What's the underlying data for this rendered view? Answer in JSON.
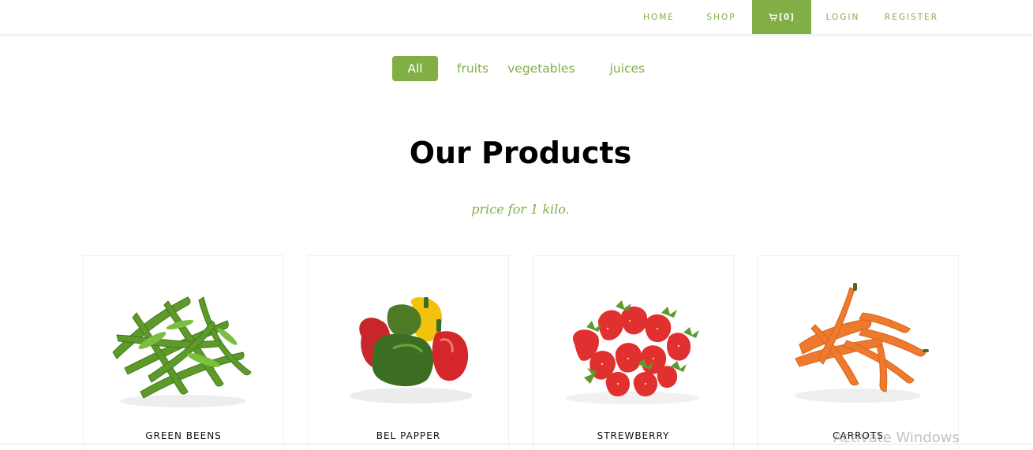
{
  "nav": {
    "home": "HOME",
    "shop": "SHOP",
    "cart": "[0]",
    "login": "LOGIN",
    "register": "REGISTER",
    "cart_icon": "cart-icon"
  },
  "filters": [
    {
      "label": "All",
      "active": true
    },
    {
      "label": "fruits",
      "active": false
    },
    {
      "label": "vegetables",
      "active": false
    },
    {
      "label": "juices",
      "active": false
    }
  ],
  "section": {
    "title": "Our Products",
    "subtitle": "price for 1 kilo."
  },
  "products": [
    {
      "name": "GREEN BEENS",
      "image": "green-beans-image"
    },
    {
      "name": "BEL PAPPER",
      "image": "bell-pepper-image"
    },
    {
      "name": "STREWBERRY",
      "image": "strawberry-image"
    },
    {
      "name": "CARROTS",
      "image": "carrots-image"
    }
  ],
  "watermark": "Activate Windows",
  "colors": {
    "accent": "#82ae46",
    "text": "#000000",
    "background": "#ffffff"
  }
}
